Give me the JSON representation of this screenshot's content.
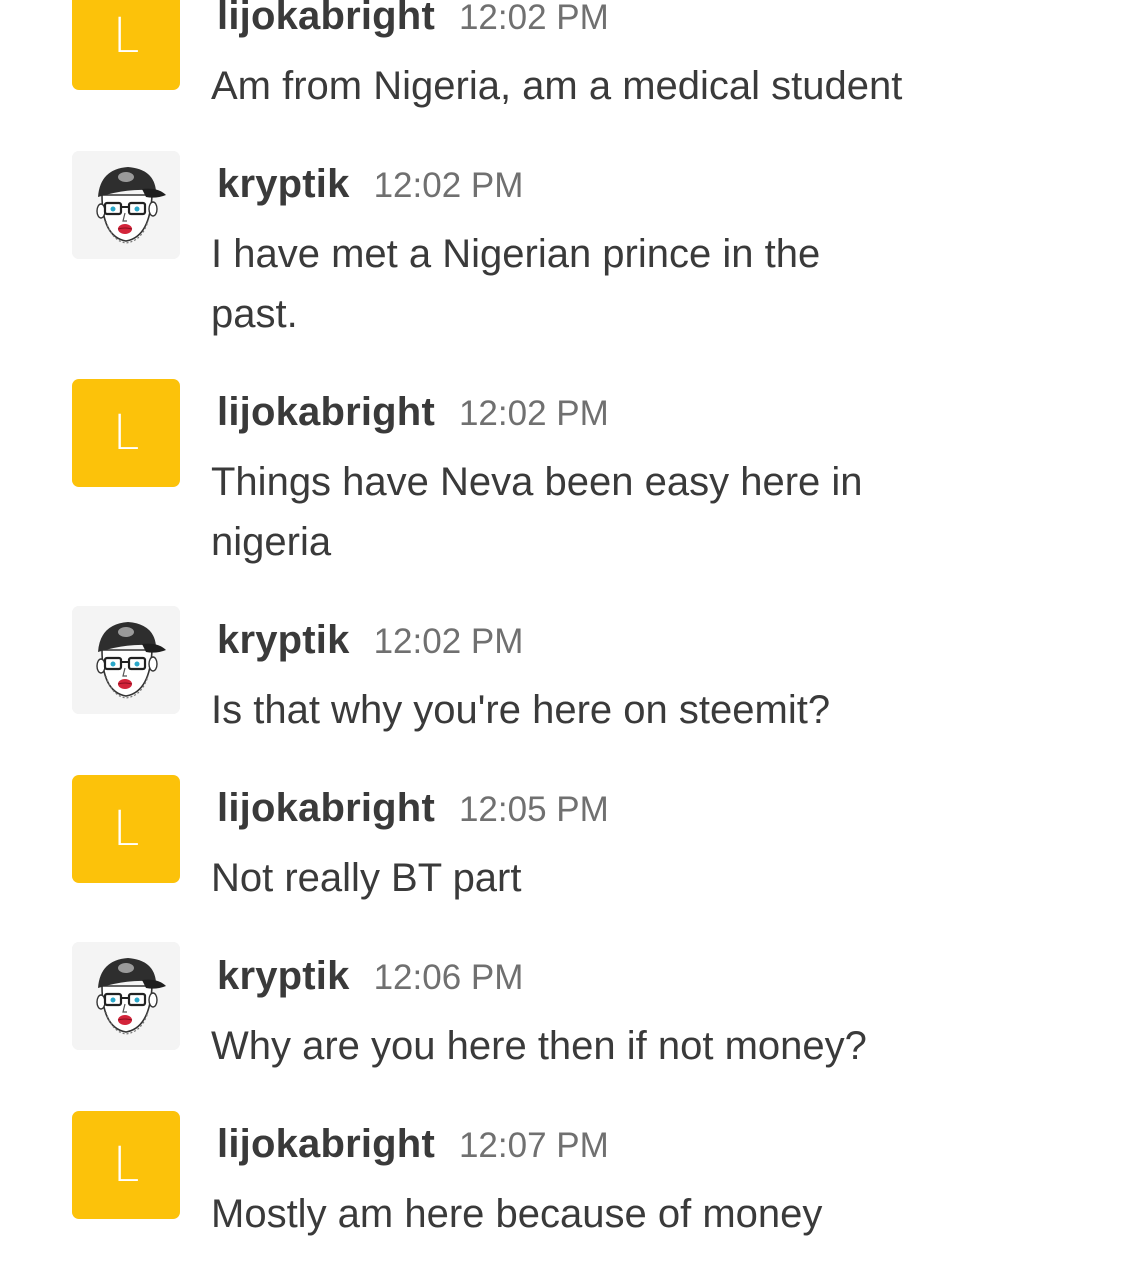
{
  "chat": {
    "messages": [
      {
        "username": "lijokabright",
        "time": "12:02 PM",
        "avatar_letter": "L",
        "avatar_type": "letter",
        "text": "Am from Nigeria, am a medical student"
      },
      {
        "username": "kryptik",
        "time": "12:02 PM",
        "avatar_type": "photo",
        "avatar_icon": "man-with-cap-glasses-icon",
        "text": "I have met a Nigerian prince in the past."
      },
      {
        "username": "lijokabright",
        "time": "12:02 PM",
        "avatar_letter": "L",
        "avatar_type": "letter",
        "text": "Things have Neva been easy here in nigeria"
      },
      {
        "username": "kryptik",
        "time": "12:02 PM",
        "avatar_type": "photo",
        "avatar_icon": "man-with-cap-glasses-icon",
        "text": "Is that why you're here on steemit?"
      },
      {
        "username": "lijokabright",
        "time": "12:05 PM",
        "avatar_letter": "L",
        "avatar_type": "letter",
        "text": "Not really BT part"
      },
      {
        "username": "kryptik",
        "time": "12:06 PM",
        "avatar_type": "photo",
        "avatar_icon": "man-with-cap-glasses-icon",
        "text": "Why are you here then if not money?"
      },
      {
        "username": "lijokabright",
        "time": "12:07 PM",
        "avatar_letter": "L",
        "avatar_type": "letter",
        "text": "Mostly am here because of money"
      }
    ]
  },
  "colors": {
    "letter_avatar_bg": "#fcc20a",
    "text": "#3a3a3a",
    "timestamp": "#707070",
    "background": "#ffffff"
  }
}
